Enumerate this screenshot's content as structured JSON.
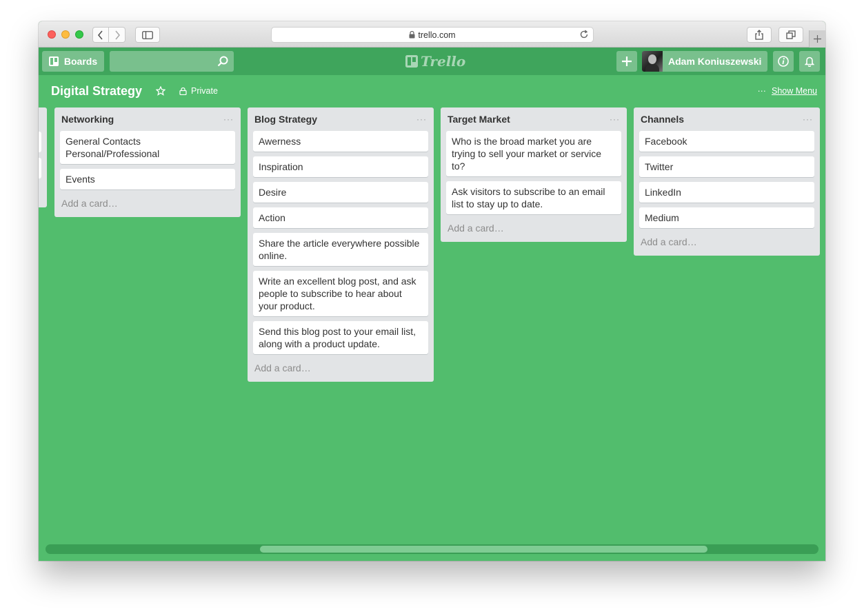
{
  "browser": {
    "url": "trello.com"
  },
  "header": {
    "boards_label": "Boards",
    "logo_text": "Trello",
    "user_name": "Adam Koniuszewski"
  },
  "board": {
    "title": "Digital Strategy",
    "visibility": "Private",
    "show_menu": "Show Menu",
    "more": "···"
  },
  "lists": [
    {
      "title": "Networking",
      "menu": "···",
      "cards": [
        "General Contacts Personal/Professional",
        "Events"
      ],
      "add_card": "Add a card…"
    },
    {
      "title": "Blog Strategy",
      "menu": "···",
      "cards": [
        "Awerness",
        "Inspiration",
        "Desire",
        "Action",
        "Share the article everywhere possible online.",
        "Write an excellent blog post, and ask people to subscribe to hear about your product.",
        "Send this blog post to your email list, along with a product update."
      ],
      "add_card": "Add a card…"
    },
    {
      "title": "Target Market",
      "menu": "···",
      "cards": [
        "Who is the broad market you are trying to sell your market or service to?",
        "Ask visitors to subscribe to an email list to stay up to date."
      ],
      "add_card": "Add a card…"
    },
    {
      "title": "Channels",
      "menu": "···",
      "cards": [
        "Facebook",
        "Twitter",
        "LinkedIn",
        "Medium"
      ],
      "add_card": "Add a card…"
    }
  ],
  "colors": {
    "board_bg": "#52bd6d",
    "header_bg": "#3fa55c",
    "list_bg": "#e2e4e6"
  }
}
